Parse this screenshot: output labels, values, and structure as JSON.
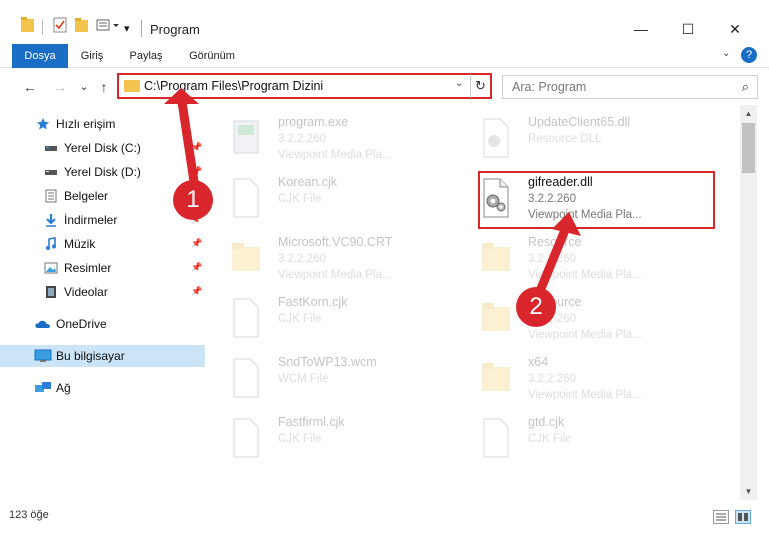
{
  "window": {
    "title": "Program",
    "minimize": "—",
    "maximize": "☐",
    "close": "✕"
  },
  "ribbon": {
    "tabs": [
      "Dosya",
      "Giriş",
      "Paylaş",
      "Görünüm"
    ],
    "help": "?"
  },
  "nav": {
    "back": "←",
    "forward": "→",
    "recent": "⌄",
    "up": "↑",
    "address": "C:\\Program Files\\Program Dizini",
    "address_dropdown": "⌄",
    "refresh": "↻",
    "search_placeholder": "Ara: Program",
    "search_icon": "⌕"
  },
  "sidebar": {
    "items": [
      {
        "label": "Hızlı erişim",
        "icon": "star-icon",
        "pinned": false
      },
      {
        "label": "Yerel Disk (C:)",
        "icon": "drive-icon",
        "pinned": true
      },
      {
        "label": "Yerel Disk (D:)",
        "icon": "drive-icon",
        "pinned": true
      },
      {
        "label": "Belgeler",
        "icon": "document-icon",
        "pinned": true
      },
      {
        "label": "İndirmeler",
        "icon": "download-icon",
        "pinned": true
      },
      {
        "label": "Müzik",
        "icon": "music-icon",
        "pinned": true
      },
      {
        "label": "Resimler",
        "icon": "picture-icon",
        "pinned": true
      },
      {
        "label": "Videolar",
        "icon": "video-icon",
        "pinned": true
      },
      {
        "label": "OneDrive",
        "icon": "cloud-icon",
        "pinned": false
      },
      {
        "label": "Bu bilgisayar",
        "icon": "computer-icon",
        "pinned": false
      },
      {
        "label": "Ağ",
        "icon": "network-icon",
        "pinned": false
      }
    ],
    "pin_glyph": "📌"
  },
  "files": {
    "left": [
      {
        "name": "program.exe",
        "sub1": "3.2.2.260",
        "sub2": "Viewpoint Media Pla...",
        "icon": "exe-icon"
      },
      {
        "name": "Korean.cjk",
        "sub1": "CJK File",
        "sub2": "",
        "icon": "blank-file-icon"
      },
      {
        "name": "Microsoft.VC90.CRT",
        "sub1": "3.2.2.260",
        "sub2": "Viewpoint Media Pla...",
        "icon": "folder-icon"
      },
      {
        "name": "FastKorn.cjk",
        "sub1": "CJK File",
        "sub2": "",
        "icon": "blank-file-icon"
      },
      {
        "name": "SndToWP13.wcm",
        "sub1": "WCM File",
        "sub2": "",
        "icon": "blank-file-icon"
      },
      {
        "name": "Fastfirml.cjk",
        "sub1": "CJK File",
        "sub2": "",
        "icon": "blank-file-icon"
      }
    ],
    "right": [
      {
        "name": "UpdateClient65.dll",
        "sub1": "Resource DLL",
        "sub2": "",
        "icon": "dll-icon"
      },
      {
        "name": "gifreader.dll",
        "sub1": "3.2.2.260",
        "sub2": "Viewpoint Media Pla...",
        "icon": "dll-icon"
      },
      {
        "name": "Resource",
        "sub1": "3.2.2.260",
        "sub2": "Viewpoint Media Pla...",
        "icon": "folder-icon"
      },
      {
        "name": "Resource",
        "sub1": "3.2.2.260",
        "sub2": "Viewpoint Media Pla...",
        "icon": "folder-icon"
      },
      {
        "name": "x64",
        "sub1": "3.2.2.260",
        "sub2": "Viewpoint Media Pla...",
        "icon": "folder-icon"
      },
      {
        "name": "gtd.cjk",
        "sub1": "CJK File",
        "sub2": "",
        "icon": "blank-file-icon"
      }
    ]
  },
  "status": {
    "count": "123 öğe"
  },
  "annotations": {
    "callout1": "1",
    "callout2": "2",
    "color": "#d9262c"
  }
}
